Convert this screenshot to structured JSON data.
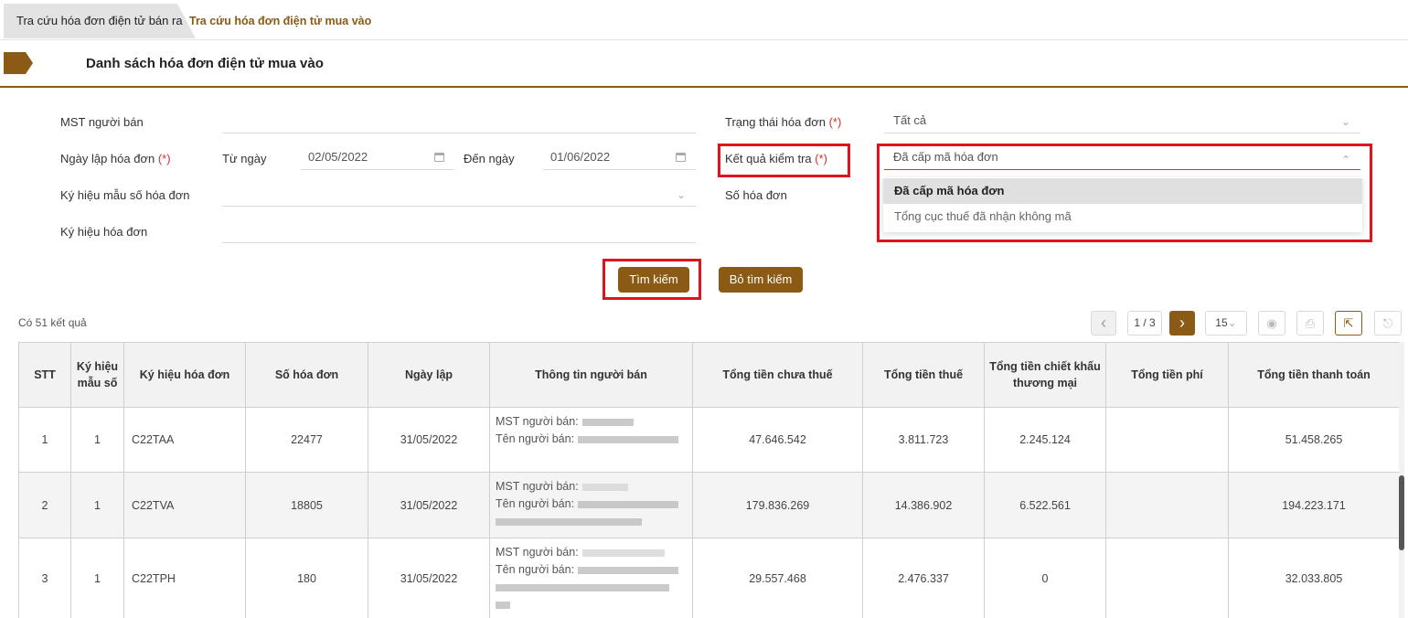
{
  "tabs": [
    {
      "label": "Tra cứu hóa đơn điện tử bán ra"
    },
    {
      "label": "Tra cứu hóa đơn điện tử mua vào"
    }
  ],
  "section": {
    "title": "Danh sách hóa đơn điện tử mua vào"
  },
  "form": {
    "mst_label": "MST người bán",
    "ngay_lap_label": "Ngày lập hóa đơn",
    "required_mark": "(*)",
    "tu_ngay_label": "Từ ngày",
    "tu_ngay_value": "02/05/2022",
    "den_ngay_label": "Đến ngày",
    "den_ngay_value": "01/06/2022",
    "ky_hieu_mau_so_label": "Ký hiệu mẫu số hóa đơn",
    "ky_hieu_hoa_don_label": "Ký hiệu hóa đơn",
    "trang_thai_label": "Trạng thái hóa đơn",
    "trang_thai_value": "Tất cả",
    "ket_qua_label": "Kết quả kiểm tra",
    "ket_qua_value": "Đã cấp mã hóa đơn",
    "so_hoa_don_label": "Số hóa đơn",
    "ket_qua_options": [
      "Đã cấp mã hóa đơn",
      "Tổng cục thuế đã nhận không mã"
    ]
  },
  "buttons": {
    "search": "Tìm kiếm",
    "clear": "Bỏ tìm kiếm"
  },
  "results": {
    "count_text": "Có 51 kết quả"
  },
  "pagination": {
    "page": "1 / 3",
    "page_size": "15"
  },
  "table": {
    "headers": [
      "STT",
      "Ký hiệu mẫu số",
      "Ký hiệu hóa đơn",
      "Số hóa đơn",
      "Ngày lập",
      "Thông tin người bán",
      "Tổng tiền chưa thuế",
      "Tổng tiền thuế",
      "Tổng tiền chiết khấu thương mại",
      "Tổng tiền phí",
      "Tổng tiền thanh toán"
    ],
    "seller_mst_label": "MST người bán:",
    "seller_name_label": "Tên người bán:",
    "rows": [
      {
        "stt": "1",
        "mau_so": "1",
        "ky_hieu": "C22TAA",
        "so": "22477",
        "ngay": "31/05/2022",
        "chua_thue": "47.646.542",
        "thue": "3.811.723",
        "chiet_khau": "2.245.124",
        "phi": "",
        "thanh_toan": "51.458.265"
      },
      {
        "stt": "2",
        "mau_so": "1",
        "ky_hieu": "C22TVA",
        "so": "18805",
        "ngay": "31/05/2022",
        "chua_thue": "179.836.269",
        "thue": "14.386.902",
        "chiet_khau": "6.522.561",
        "phi": "",
        "thanh_toan": "194.223.171"
      },
      {
        "stt": "3",
        "mau_so": "1",
        "ky_hieu": "C22TPH",
        "so": "180",
        "ngay": "31/05/2022",
        "chua_thue": "29.557.468",
        "thue": "2.476.337",
        "chiet_khau": "0",
        "phi": "",
        "thanh_toan": "32.033.805"
      }
    ]
  },
  "colors": {
    "brand": "#8b5a14",
    "highlight": "#e0131d",
    "required": "#d32f2f"
  }
}
